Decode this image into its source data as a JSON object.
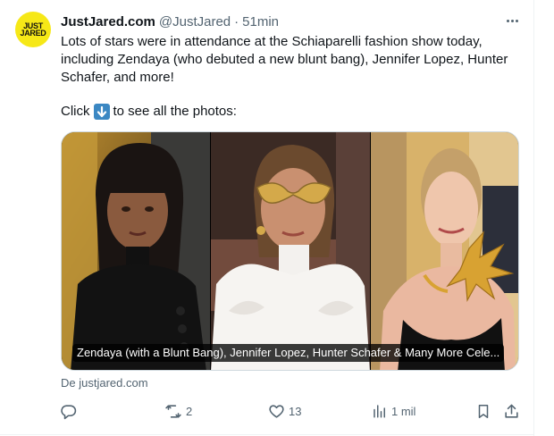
{
  "tweet": {
    "author_name": "JustJared.com",
    "handle": "@JustJared",
    "separator": "·",
    "time": "51min",
    "avatar_text": [
      "JUST",
      "JARED"
    ],
    "text_lines": [
      "Lots of stars were in attendance at the Schiaparelli fashion show today, including Zendaya (who debuted a new blunt bang), Jennifer Lopez, Hunter Schafer, and more!"
    ],
    "click_prefix": "Click",
    "click_suffix": "to see all the photos:",
    "emoji_icon": "down-arrow-emoji-icon"
  },
  "media": {
    "caption": "Zendaya (with a Blunt Bang), Jennifer Lopez, Hunter Schafer & Many More Cele...",
    "source": "De justjared.com",
    "photos": [
      "zendaya-photo",
      "jennifer-lopez-photo",
      "hunter-schafer-photo"
    ]
  },
  "actions": {
    "reply": {
      "icon": "reply-icon",
      "count": ""
    },
    "retweet": {
      "icon": "retweet-icon",
      "count": "2"
    },
    "like": {
      "icon": "heart-icon",
      "count": "13"
    },
    "views": {
      "icon": "views-icon",
      "count": "1 mil"
    },
    "bookmark": {
      "icon": "bookmark-icon"
    },
    "share": {
      "icon": "share-icon"
    }
  },
  "colors": {
    "avatar_bg": "#f6e817",
    "text": "#0f1419",
    "secondary": "#536471",
    "border": "#eff3f4"
  }
}
